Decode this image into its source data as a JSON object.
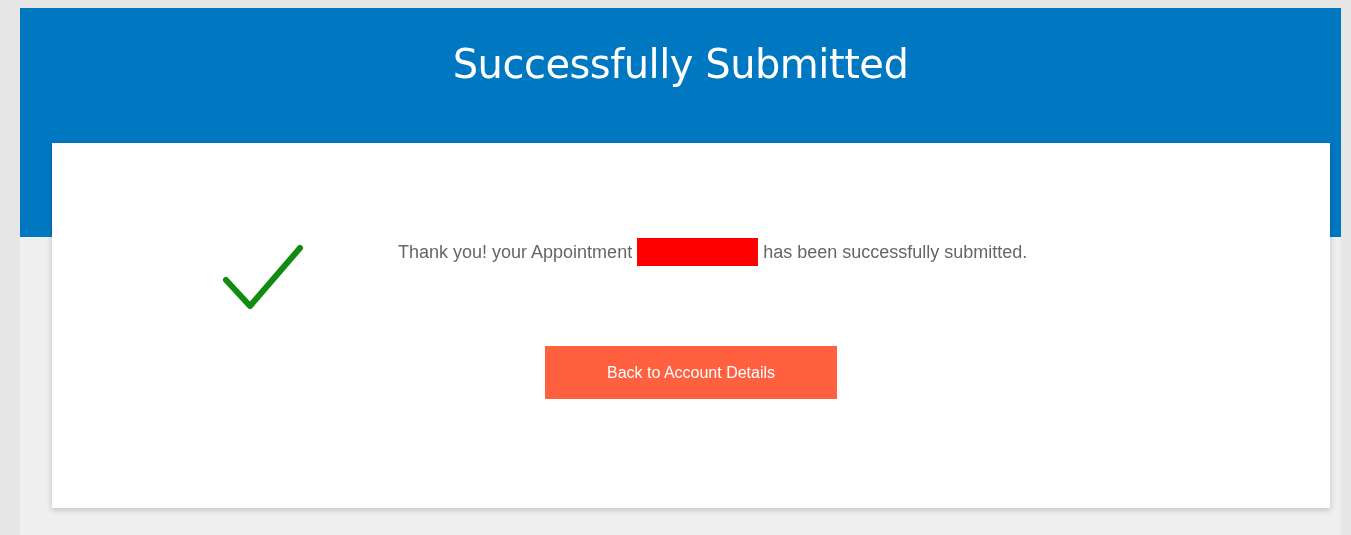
{
  "header": {
    "title": "Successfully Submitted"
  },
  "message": {
    "before": "Thank you! your Appointment",
    "after": "has been successfully submitted.",
    "redacted": true
  },
  "button": {
    "label": "Back to Account Details"
  }
}
